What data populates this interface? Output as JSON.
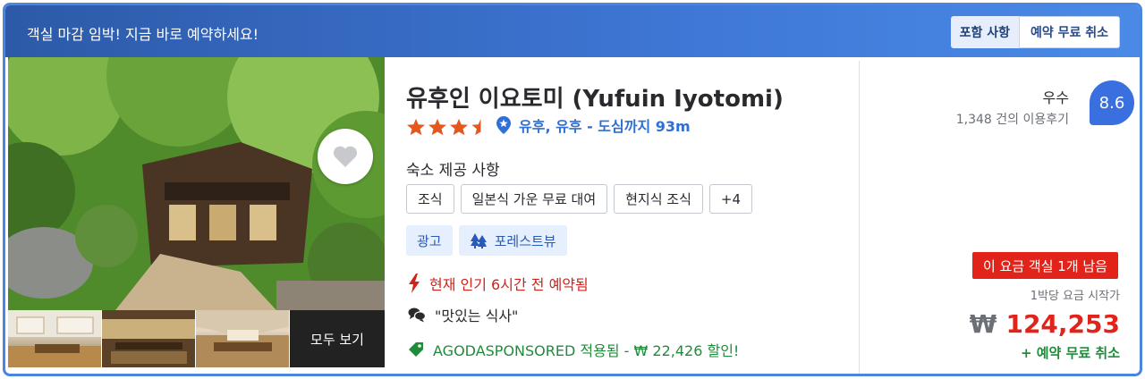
{
  "banner": {
    "text": "객실 마감 임박! 지금 바로 예약하세요!",
    "included_label": "포함 사항",
    "free_cancel_label": "예약 무료 취소"
  },
  "photos": {
    "view_all_label": "모두 보기"
  },
  "hotel": {
    "name": "유후인 이요토미 (Yufuin Iyotomi)",
    "star_rating": 3.5,
    "location": "유후, 유후 - 도심까지 93m",
    "facilities_title": "숙소 제공 사항",
    "facilities": [
      "조식",
      "일본식 가운 무료 대여",
      "현지식 조식",
      "+4"
    ],
    "ad_label": "광고",
    "forest_label": "포레스트뷰",
    "popular_text": "현재 인기 6시간 전 예약됨",
    "review_quote": "\"맛있는 식사\"",
    "promo_text": "AGODASPONSORED 적용됨 - ₩ 22,426 할인!"
  },
  "rating": {
    "label": "우수",
    "reviews": "1,348 건의 이용후기",
    "score": "8.6"
  },
  "pricing": {
    "scarcity": "이 요금 객실 1개 남음",
    "note": "1박당 요금 시작가",
    "currency": "₩",
    "amount": "124,253",
    "free_cancel": "+ 예약 무료 취소"
  },
  "colors": {
    "accent": "#3f77d6",
    "price_red": "#e2231a",
    "promo_green": "#1f8c3a",
    "star_orange": "#e4581f"
  }
}
